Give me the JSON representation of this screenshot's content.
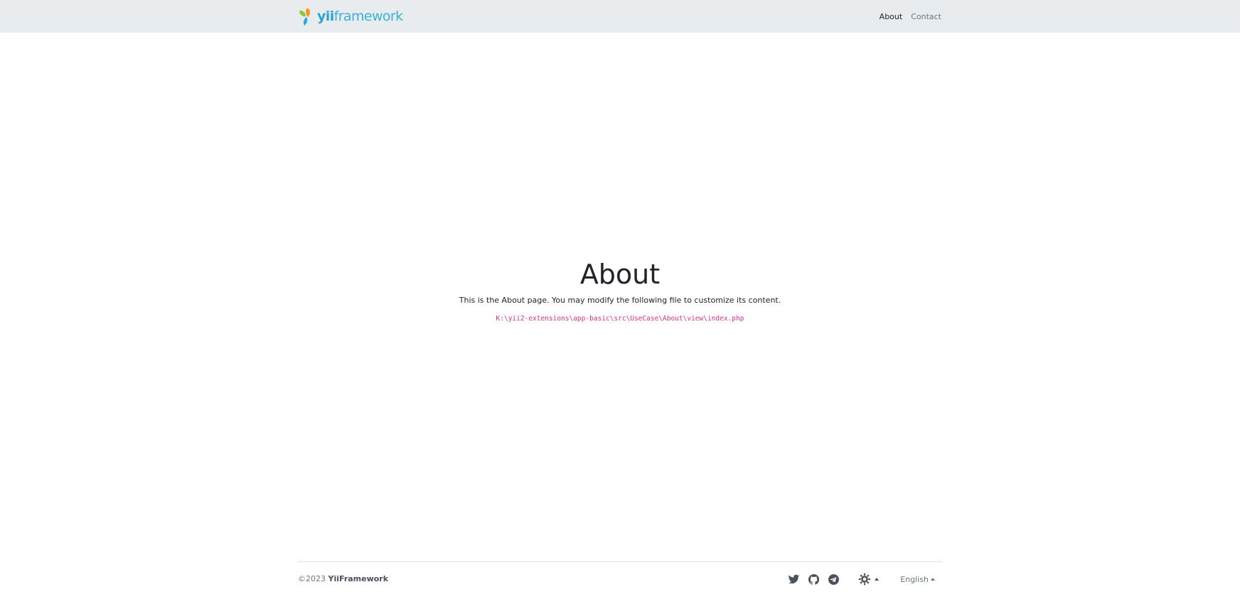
{
  "navbar": {
    "brand": {
      "prefix": "yii",
      "suffix": "framework"
    },
    "links": [
      {
        "label": "About",
        "active": true
      },
      {
        "label": "Contact",
        "active": false
      }
    ]
  },
  "main": {
    "title": "About",
    "description": "This is the About page. You may modify the following file to customize its content.",
    "file_path": "K:\\yii2-extensions\\app-basic\\src\\UseCase\\About\\view\\index.php"
  },
  "footer": {
    "copyright_prefix": "©2023",
    "copyright_brand": "YiiFramework",
    "social_icons": [
      "twitter-icon",
      "github-icon",
      "telegram-icon"
    ],
    "theme_icon": "sun-icon",
    "language": "English"
  },
  "colors": {
    "navbar_bg": "#e9ecef",
    "brand": "#3ab1d8",
    "code": "#d63384"
  }
}
